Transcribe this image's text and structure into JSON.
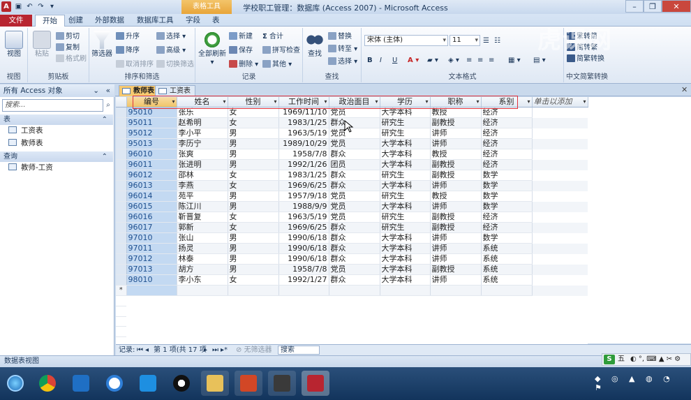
{
  "window": {
    "title": "学校职工管理：数据库 (Access 2007) - Microsoft Access",
    "context_group": "表格工具"
  },
  "ribbon_tabs": [
    "文件",
    "开始",
    "创建",
    "外部数据",
    "数据库工具",
    "字段",
    "表"
  ],
  "ribbon": {
    "views": {
      "view": "视图",
      "label": "视图"
    },
    "clipboard": {
      "paste": "粘贴",
      "cut": "剪切",
      "copy": "复制",
      "format_painter": "格式刷",
      "label": "剪贴板"
    },
    "sort_filter": {
      "filter": "筛选器",
      "ascending": "升序",
      "descending": "降序",
      "clear_sort": "取消排序",
      "selection": "选择",
      "advanced": "高级",
      "toggle_filter": "切换筛选",
      "label": "排序和筛选"
    },
    "records": {
      "refresh": "全部刷新",
      "new": "新建",
      "save": "保存",
      "delete": "删除",
      "totals": "合计",
      "spelling": "拼写检查",
      "more": "其他",
      "label": "记录"
    },
    "find": {
      "find": "查找",
      "replace": "替换",
      "goto": "转至",
      "select": "选择",
      "label": "查找"
    },
    "text_format": {
      "font": "宋体 (主体)",
      "size": "11",
      "bold": "B",
      "italic": "I",
      "underline": "U",
      "label": "文本格式"
    },
    "chinese": {
      "to_trad": "繁转简",
      "to_simp": "简转繁",
      "convert": "简繁转换",
      "label": "中文简繁转换"
    }
  },
  "nav": {
    "header": "所有 Access 对象",
    "search_placeholder": "搜索...",
    "section_tables": "表",
    "tables": [
      "工资表",
      "教师表"
    ],
    "section_queries": "查询",
    "queries": [
      "教师-工资"
    ]
  },
  "doc_tabs": [
    "教师表",
    "工资表"
  ],
  "grid": {
    "columns": [
      "编号",
      "姓名",
      "性别",
      "工作时间",
      "政治面目",
      "学历",
      "职称",
      "系别",
      "单击以添加"
    ],
    "rows": [
      [
        "95010",
        "张乐",
        "女",
        "1969/11/10",
        "党员",
        "大学本科",
        "教授",
        "经济"
      ],
      [
        "95011",
        "赵希明",
        "女",
        "1983/1/25",
        "群众",
        "研究生",
        "副教授",
        "经济"
      ],
      [
        "95012",
        "李小平",
        "男",
        "1963/5/19",
        "党员",
        "研究生",
        "讲师",
        "经济"
      ],
      [
        "95013",
        "李历宁",
        "男",
        "1989/10/29",
        "党员",
        "大学本科",
        "讲师",
        "经济"
      ],
      [
        "96010",
        "张爽",
        "男",
        "1958/7/8",
        "群众",
        "大学本科",
        "教授",
        "经济"
      ],
      [
        "96011",
        "张进明",
        "男",
        "1992/1/26",
        "团员",
        "大学本科",
        "副教授",
        "经济"
      ],
      [
        "96012",
        "邵林",
        "女",
        "1983/1/25",
        "群众",
        "研究生",
        "副教授",
        "数学"
      ],
      [
        "96013",
        "李燕",
        "女",
        "1969/6/25",
        "群众",
        "大学本科",
        "讲师",
        "数学"
      ],
      [
        "96014",
        "苑平",
        "男",
        "1957/9/18",
        "党员",
        "研究生",
        "教授",
        "数学"
      ],
      [
        "96015",
        "陈江川",
        "男",
        "1988/9/9",
        "党员",
        "大学本科",
        "讲师",
        "数学"
      ],
      [
        "96016",
        "靳晋复",
        "女",
        "1963/5/19",
        "党员",
        "研究生",
        "副教授",
        "经济"
      ],
      [
        "96017",
        "郭新",
        "女",
        "1969/6/25",
        "群众",
        "研究生",
        "副教授",
        "经济"
      ],
      [
        "97010",
        "张山",
        "男",
        "1990/6/18",
        "群众",
        "大学本科",
        "讲师",
        "数学"
      ],
      [
        "97011",
        "扬灵",
        "男",
        "1990/6/18",
        "群众",
        "大学本科",
        "讲师",
        "系统"
      ],
      [
        "97012",
        "林泰",
        "男",
        "1990/6/18",
        "群众",
        "大学本科",
        "讲师",
        "系统"
      ],
      [
        "97013",
        "胡方",
        "男",
        "1958/7/8",
        "党员",
        "大学本科",
        "副教授",
        "系统"
      ],
      [
        "98010",
        "李小东",
        "女",
        "1992/1/27",
        "群众",
        "大学本科",
        "讲师",
        "系统"
      ]
    ],
    "new_row_marker": "*"
  },
  "record_nav": {
    "label": "记录:",
    "position": "第 1 项(共 17 项",
    "no_filter": "无筛选器",
    "search": "搜索"
  },
  "status": "数据表视图",
  "ime": "五",
  "watermark": "虎课网",
  "colors": {
    "file_tab": "#b82530",
    "context_tab": "#f0c46a",
    "highlight_box": "#e0313b",
    "selected_col": "#c3d9f2"
  }
}
